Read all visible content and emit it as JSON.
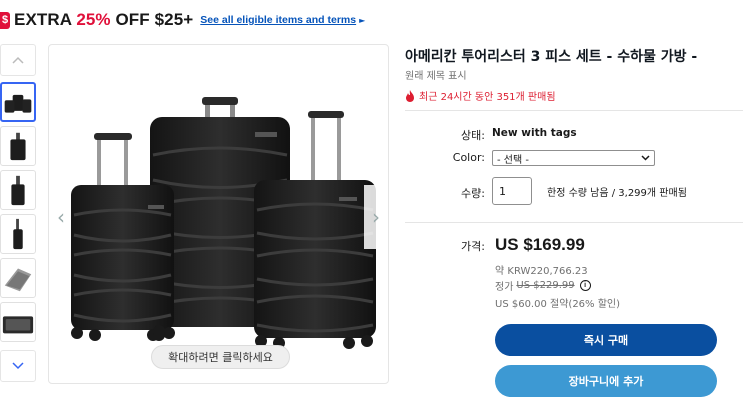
{
  "promo": {
    "tag_glyph": "$",
    "text_prefix": "EXTRA ",
    "percent": "25%",
    "text_suffix": " OFF $25+",
    "link": "See all eligible items and terms",
    "link_arrow": "►"
  },
  "thumbnails": {
    "up_icon": "chevron-up-icon",
    "down_icon": "chevron-down-icon",
    "count": 6,
    "selected_index": 0
  },
  "main_image": {
    "zoom_hint": "확대하려면 클릭하세요",
    "prev_glyph": "‹",
    "next_glyph": "›"
  },
  "product": {
    "title": "아메리칸 투어리스터 3 피스 세트 - 수하물 가방 -",
    "original_title_link": "원래 제목 표시",
    "sold_recent": "최근 24시간 동안 351개 판매됨"
  },
  "details": {
    "condition_label": "상태:",
    "condition_value": "New with tags",
    "color_label": "Color:",
    "color_selected": "- 선택 -",
    "qty_label": "수량:",
    "qty_value": "1",
    "qty_note": "한정 수량 남음 / 3,299개 판매됨"
  },
  "pricing": {
    "price_label": "가격:",
    "price": "US $169.99",
    "approx_prefix": "약 ",
    "approx_value": "KRW220,766.23",
    "list_prefix": "정가",
    "list_price": "US $229.99",
    "info_glyph": "i",
    "savings": "US $60.00 절약(26% 할인)"
  },
  "actions": {
    "buy_now": "즉시 구매",
    "add_to_cart": "장바구니에 추가"
  },
  "colors": {
    "accent_red": "#e0103a",
    "link_blue": "#0654ba",
    "buy_button": "#0a4fa0",
    "cart_button": "#3d99d3",
    "hot_red": "#dd1e31"
  }
}
